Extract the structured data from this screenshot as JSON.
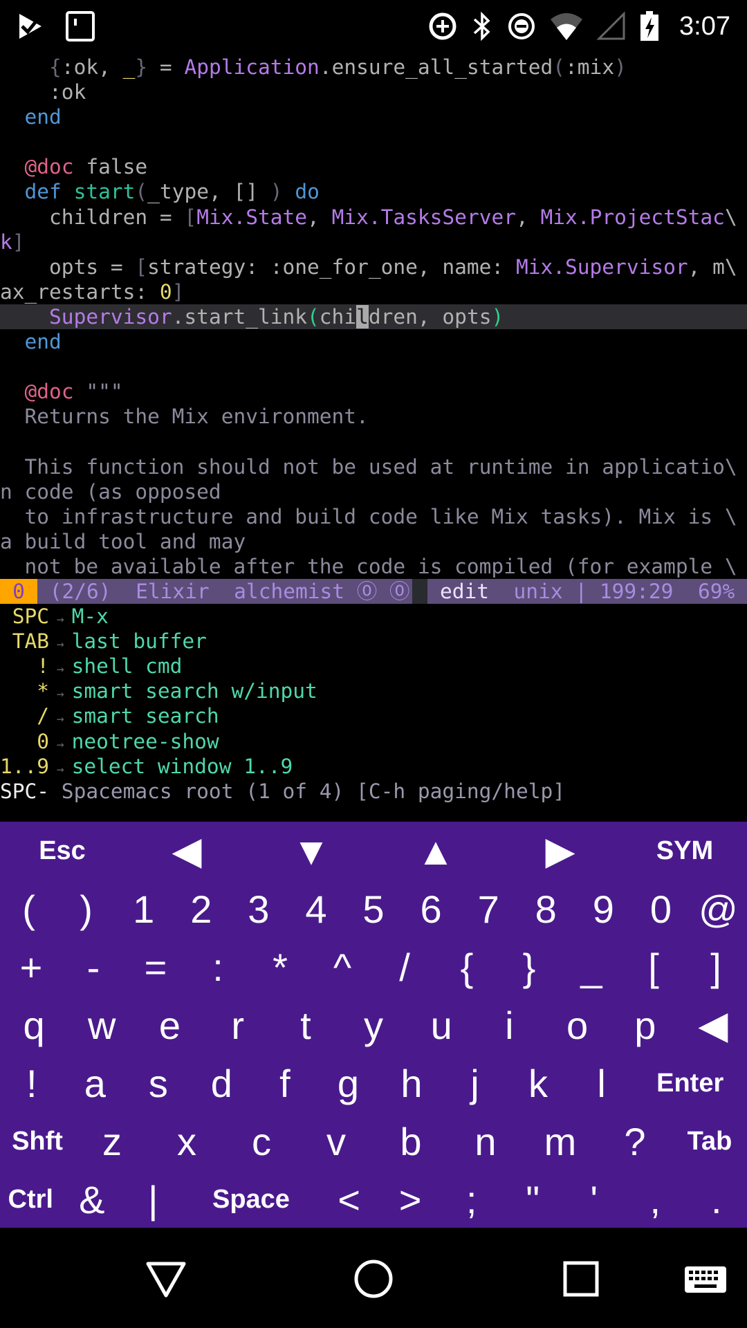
{
  "status_bar": {
    "time": "3:07",
    "icons": [
      "check-notification-icon",
      "sim-card-icon",
      "data-saver-icon",
      "bluetooth-icon",
      "do-not-disturb-icon",
      "wifi-icon",
      "cell-signal-icon",
      "battery-charging-icon"
    ]
  },
  "editor": {
    "lines": [
      [
        [
          "    ",
          "d"
        ],
        [
          "{",
          "p"
        ],
        [
          ":ok, ",
          "d"
        ],
        [
          "_",
          "u"
        ],
        [
          "}",
          "p"
        ],
        [
          " = ",
          "d"
        ],
        [
          "Application",
          "m"
        ],
        [
          ".ensure_all_started",
          "d"
        ],
        [
          "(",
          "p"
        ],
        [
          ":mix",
          "d"
        ],
        [
          ")",
          "p"
        ]
      ],
      [
        [
          "    :ok",
          "d"
        ]
      ],
      [
        [
          "  ",
          "d"
        ],
        [
          "end",
          "k"
        ]
      ],
      [],
      [
        [
          "  ",
          "d"
        ],
        [
          "@doc",
          "a"
        ],
        [
          " false",
          "d"
        ]
      ],
      [
        [
          "  ",
          "d"
        ],
        [
          "def",
          "k"
        ],
        [
          " ",
          "d"
        ],
        [
          "start",
          "f"
        ],
        [
          "(",
          "p"
        ],
        [
          "_type",
          "d"
        ],
        [
          ", [] ",
          "d"
        ],
        [
          ")",
          "p"
        ],
        [
          " ",
          "d"
        ],
        [
          "do",
          "k"
        ]
      ],
      [
        [
          "    children = ",
          "d"
        ],
        [
          "[",
          "p"
        ],
        [
          "Mix.State",
          "m"
        ],
        [
          ", ",
          "d"
        ],
        [
          "Mix.TasksServer",
          "m"
        ],
        [
          ", ",
          "d"
        ],
        [
          "Mix.ProjectStac",
          "m"
        ],
        [
          "\\",
          "d"
        ]
      ],
      [
        [
          "k",
          "m"
        ],
        [
          "]",
          "p"
        ]
      ],
      [
        [
          "    opts = ",
          "d"
        ],
        [
          "[",
          "p"
        ],
        [
          "strategy: :one_for_one, name: ",
          "d"
        ],
        [
          "Mix.Supervisor",
          "m"
        ],
        [
          ", m\\",
          "d"
        ]
      ],
      [
        [
          "ax_restarts: ",
          "d"
        ],
        [
          "0",
          "n"
        ],
        [
          "]",
          "p"
        ]
      ],
      [
        [
          "    ",
          "d"
        ],
        [
          "Supervisor",
          "m"
        ],
        [
          ".start_link",
          "d"
        ],
        [
          "(",
          "g"
        ],
        [
          "chi",
          "d"
        ],
        [
          "l",
          "cursor"
        ],
        [
          "dren, opts",
          "d"
        ],
        [
          ")",
          "g"
        ]
      ],
      [
        [
          "  ",
          "d"
        ],
        [
          "end",
          "k"
        ]
      ],
      [],
      [
        [
          "  ",
          "d"
        ],
        [
          "@doc",
          "a"
        ],
        [
          " \"\"\"",
          "c"
        ]
      ],
      [
        [
          "  Returns the Mix environment.",
          "c"
        ]
      ],
      [],
      [
        [
          "  This function should not be used at runtime in applicatio\\",
          "c"
        ]
      ],
      [
        [
          "n code (as opposed",
          "c"
        ]
      ],
      [
        [
          "  to infrastructure and build code like Mix tasks). Mix is \\",
          "c"
        ]
      ],
      [
        [
          "a build tool and may",
          "c"
        ]
      ],
      [
        [
          "  not be available after the code is compiled (for example \\",
          "c"
        ]
      ]
    ],
    "highlighted_line": 10
  },
  "modeline": {
    "window_number": "0",
    "buffer_info": " (2/6)  Elixir  alchemist ⓪ ⓪",
    "state": "edit",
    "position_info": "unix | 199:29  69% "
  },
  "which_key": {
    "items": [
      {
        "key": " SPC",
        "desc": "M-x"
      },
      {
        "key": " TAB",
        "desc": "last buffer"
      },
      {
        "key": "   !",
        "desc": "shell cmd"
      },
      {
        "key": "   *",
        "desc": "smart search w/input"
      },
      {
        "key": "   /",
        "desc": "smart search"
      },
      {
        "key": "   0",
        "desc": "neotree-show"
      },
      {
        "key": "1..9",
        "desc": "select window 1..9"
      }
    ],
    "arrow": " → ",
    "footer_prefix": "SPC-",
    "footer_text": " Spacemacs root (1 of 4) [C-h paging/help]"
  },
  "keyboard": {
    "rows": [
      [
        "Esc",
        "◀",
        "▼",
        "▲",
        "▶",
        "SYM"
      ],
      [
        "(",
        ")",
        "1",
        "2",
        "3",
        "4",
        "5",
        "6",
        "7",
        "8",
        "9",
        "0",
        "@"
      ],
      [
        "+",
        "-",
        "=",
        ":",
        "*",
        "^",
        "/",
        "{",
        "}",
        "_",
        "[",
        "]"
      ],
      [
        "q",
        "w",
        "e",
        "r",
        "t",
        "y",
        "u",
        "i",
        "o",
        "p",
        "◀"
      ],
      [
        "!",
        "a",
        "s",
        "d",
        "f",
        "g",
        "h",
        "j",
        "k",
        "l",
        "Enter"
      ],
      [
        "Shft",
        "z",
        "x",
        "c",
        "v",
        "b",
        "n",
        "m",
        "?",
        "Tab"
      ],
      [
        "Ctrl",
        "&",
        "|",
        "Space",
        "<",
        ">",
        ";",
        "\"",
        "'",
        ",",
        "."
      ]
    ],
    "background": "#4a1a8c"
  },
  "nav_bar": {
    "buttons": [
      "back-icon",
      "home-icon",
      "recents-icon",
      "keyboard-switch-icon"
    ]
  }
}
